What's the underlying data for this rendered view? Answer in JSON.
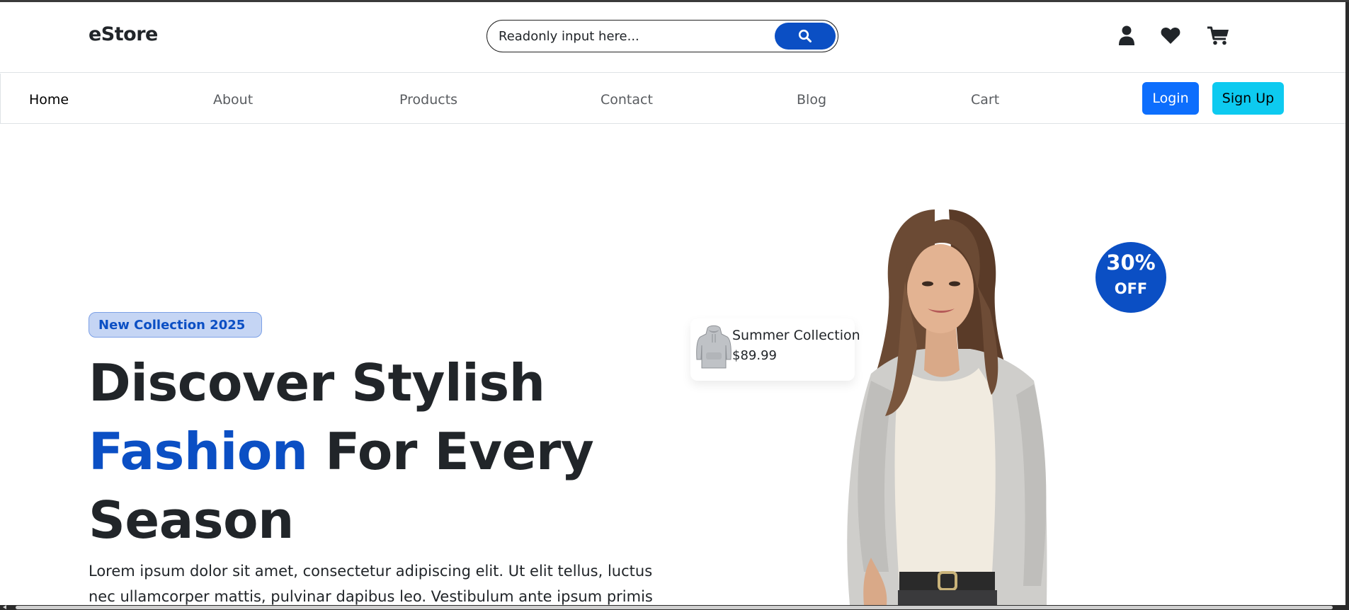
{
  "header": {
    "brand": "eStore",
    "search_placeholder": "Readonly input here..."
  },
  "nav": {
    "links": [
      "Home",
      "About",
      "Products",
      "Contact",
      "Blog",
      "Cart"
    ],
    "login_label": "Login",
    "signup_label": "Sign Up"
  },
  "hero": {
    "badge": "New Collection 2025",
    "title_line1": "Discover Stylish",
    "title_accent": "Fashion",
    "title_rest": "For Every",
    "title_line3": "Season",
    "text": "Lorem ipsum dolor sit amet, consectetur adipiscing elit. Ut elit tellus, luctus nec ullamcorper mattis, pulvinar dapibus leo. Vestibulum ante ipsum primis"
  },
  "product_card": {
    "name": "Summer Collection",
    "price": "$89.99"
  },
  "discount": {
    "value": "30%",
    "label": "OFF"
  },
  "icons": [
    "search-icon",
    "user-icon",
    "heart-icon",
    "cart-icon"
  ],
  "colors": {
    "accent": "#0b4fc4",
    "login": "#0d6efd",
    "signup": "#0dcaf0",
    "badge_bg": "#c5d5f4"
  }
}
